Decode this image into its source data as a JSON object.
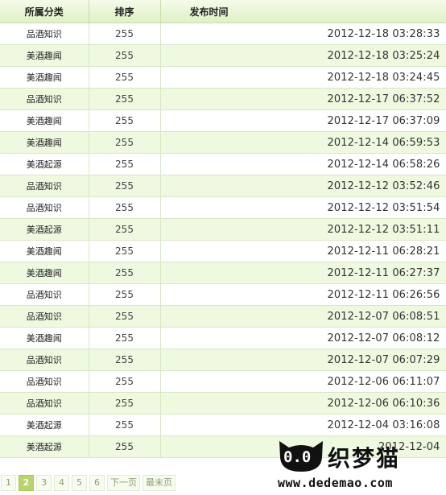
{
  "table": {
    "headers": {
      "category": "所属分类",
      "order": "排序",
      "publish_time": "发布时间"
    },
    "rows": [
      {
        "category": "品酒知识",
        "order": "255",
        "time": "2012-12-18 03:28:33"
      },
      {
        "category": "美酒趣闻",
        "order": "255",
        "time": "2012-12-18 03:25:24"
      },
      {
        "category": "美酒趣闻",
        "order": "255",
        "time": "2012-12-18 03:24:45"
      },
      {
        "category": "品酒知识",
        "order": "255",
        "time": "2012-12-17 06:37:52"
      },
      {
        "category": "美酒趣闻",
        "order": "255",
        "time": "2012-12-17 06:37:09"
      },
      {
        "category": "美酒趣闻",
        "order": "255",
        "time": "2012-12-14 06:59:53"
      },
      {
        "category": "美酒起源",
        "order": "255",
        "time": "2012-12-14 06:58:26"
      },
      {
        "category": "品酒知识",
        "order": "255",
        "time": "2012-12-12 03:52:46"
      },
      {
        "category": "品酒知识",
        "order": "255",
        "time": "2012-12-12 03:51:54"
      },
      {
        "category": "美酒起源",
        "order": "255",
        "time": "2012-12-12 03:51:11"
      },
      {
        "category": "美酒趣闻",
        "order": "255",
        "time": "2012-12-11 06:28:21"
      },
      {
        "category": "美酒趣闻",
        "order": "255",
        "time": "2012-12-11 06:27:37"
      },
      {
        "category": "品酒知识",
        "order": "255",
        "time": "2012-12-11 06:26:56"
      },
      {
        "category": "品酒知识",
        "order": "255",
        "time": "2012-12-07 06:08:51"
      },
      {
        "category": "美酒趣闻",
        "order": "255",
        "time": "2012-12-07 06:08:12"
      },
      {
        "category": "品酒知识",
        "order": "255",
        "time": "2012-12-07 06:07:29"
      },
      {
        "category": "品酒知识",
        "order": "255",
        "time": "2012-12-06 06:11:07"
      },
      {
        "category": "品酒知识",
        "order": "255",
        "time": "2012-12-06 06:10:36"
      },
      {
        "category": "美酒起源",
        "order": "255",
        "time": "2012-12-04 03:16:08"
      },
      {
        "category": "美酒起源",
        "order": "255",
        "time": "2012-12-04"
      }
    ]
  },
  "pager": {
    "pages": [
      "1",
      "2",
      "3",
      "4",
      "5",
      "6"
    ],
    "current": "2",
    "next": "下一页",
    "last": "最末页"
  },
  "watermark": {
    "eyes": "0.0",
    "brand_cn": "织梦猫",
    "url": "www.dedemao.com"
  },
  "colors": {
    "header_bg": "#dff0c6",
    "alt_row_bg": "#eef9e0",
    "grid_border": "#d9e7c8",
    "pager_current": "#b8d46a"
  }
}
